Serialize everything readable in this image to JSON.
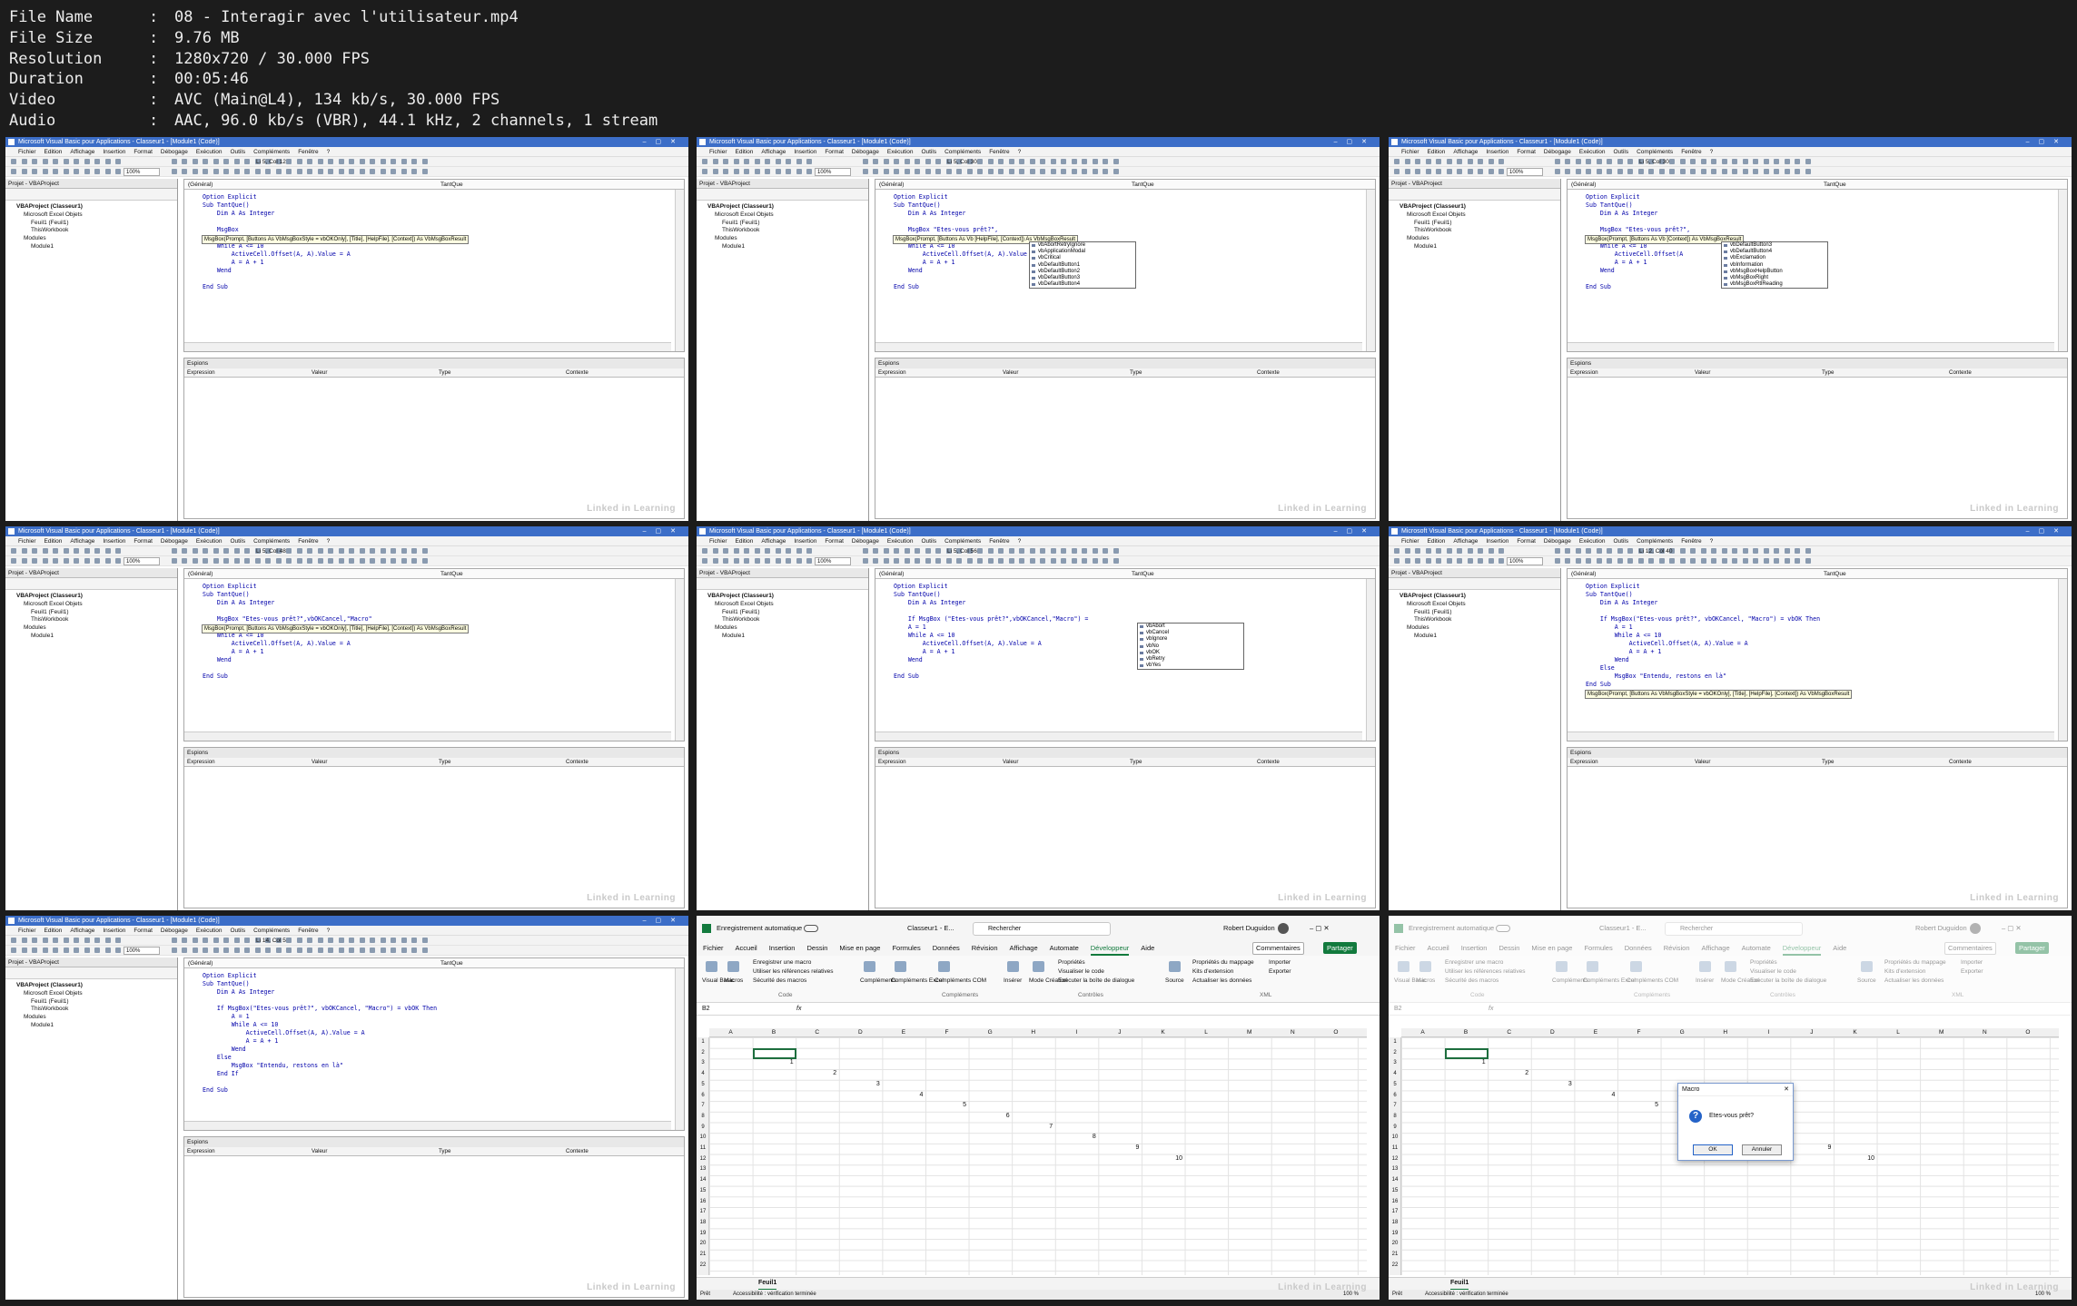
{
  "meta": [
    {
      "key": "File Name",
      "value": "08 - Interagir avec l'utilisateur.mp4"
    },
    {
      "key": "File Size",
      "value": "9.76 MB"
    },
    {
      "key": "Resolution",
      "value": "1280x720 / 30.000 FPS"
    },
    {
      "key": "Duration",
      "value": "00:05:46"
    },
    {
      "key": "Video",
      "value": "AVC (Main@L4), 134 kb/s, 30.000 FPS"
    },
    {
      "key": "Audio",
      "value": "AAC, 96.0 kb/s (VBR), 44.1 kHz, 2 channels, 1 stream"
    }
  ],
  "vba": {
    "title": "Microsoft Visual Basic pour Applications - Classeur1 - [Module1 (Code)]",
    "menu": [
      "Fichier",
      "Edition",
      "Affichage",
      "Insertion",
      "Format",
      "Débogage",
      "Exécution",
      "Outils",
      "Compléments",
      "Fenêtre",
      "?"
    ],
    "zoom": "100%",
    "project_header": "Projet - VBAProject",
    "tree": [
      "VBAProject (Classeur1)",
      "Microsoft Excel Objets",
      "Feuil1 (Feuil1)",
      "ThisWorkbook",
      "Modules",
      "Module1"
    ],
    "dropdown_left": "(Général)",
    "dropdown_right": "TantQue",
    "espions_title": "Espions",
    "espions_cols": [
      "Expression",
      "Valeur",
      "Type",
      "Contexte"
    ],
    "watermark": "Linked in Learning"
  },
  "vba_frames": [
    {
      "pos": "Li 5, Col 12",
      "code": [
        "Option Explicit",
        "Sub TantQue()",
        "    Dim A As Integer",
        "",
        "    MsgBox",
        "",
        "    While A <= 10",
        "        ActiveCell.Offset(A, A).Value = A",
        "        A = A + 1",
        "    Wend",
        "",
        "End Sub"
      ],
      "tip": "MsgBox(Prompt, [Buttons As VbMsgBoxStyle = vbOKOnly], [Title], [HelpFile], [Context]) As VbMsgBoxResult",
      "tip_line": 5,
      "list": []
    },
    {
      "pos": "Li 5, Col 30",
      "code": [
        "Option Explicit",
        "Sub TantQue()",
        "    Dim A As Integer",
        "",
        "    MsgBox \"Etes-vous prêt?\",",
        "",
        "    While A <= 10",
        "        ActiveCell.Offset(A, A).Value = A",
        "        A = A + 1",
        "    Wend",
        "",
        "End Sub"
      ],
      "tip": "MsgBox(Prompt, [Buttons As Vb                    [HelpFile], [Context]) As VbMsgBoxResult",
      "tip_line": 5,
      "list": [
        "vbAbortRetryIgnore",
        "vbApplicationModal",
        "vbCritical",
        "vbDefaultButton1",
        "vbDefaultButton2",
        "vbDefaultButton3",
        "vbDefaultButton4"
      ]
    },
    {
      "pos": "Li 5, Col 30",
      "code": [
        "Option Explicit",
        "Sub TantQue()",
        "    Dim A As Integer",
        "",
        "    MsgBox \"Etes-vous prêt?\",",
        "",
        "    While A <= 10",
        "        ActiveCell.Offset(A",
        "        A = A + 1",
        "    Wend",
        "",
        "End Sub"
      ],
      "tip": "MsgBox(Prompt, [Buttons As Vb                 [Context]) As VbMsgBoxResult",
      "tip_line": 5,
      "list": [
        "vbDefaultButton3",
        "vbDefaultButton4",
        "vbExclamation",
        "vbInformation",
        "vbMsgBoxHelpButton",
        "vbMsgBoxRight",
        "vbMsgBoxRtlReading"
      ]
    },
    {
      "pos": "Li 5, Col 48",
      "code": [
        "Option Explicit",
        "Sub TantQue()",
        "    Dim A As Integer",
        "",
        "    MsgBox \"Etes-vous prêt?\",vbOKCancel,\"Macro\"",
        "",
        "    While A <= 10",
        "        ActiveCell.Offset(A, A).Value = A",
        "        A = A + 1",
        "    Wend",
        "",
        "End Sub"
      ],
      "tip": "MsgBox(Prompt, [Buttons As VbMsgBoxStyle = vbOKOnly], [Title], [HelpFile], [Context]) As VbMsgBoxResult",
      "tip_line": 5,
      "list": []
    },
    {
      "pos": "Li 5, Col 56",
      "code": [
        "Option Explicit",
        "Sub TantQue()",
        "    Dim A As Integer",
        "",
        "    If MsgBox (\"Etes-vous prêt?\",vbOKCancel,\"Macro\") =",
        "    A = 1",
        "    While A <= 10",
        "        ActiveCell.Offset(A, A).Value = A",
        "        A = A + 1",
        "    Wend",
        "",
        "End Sub"
      ],
      "tip": "",
      "tip_line": 0,
      "list": [
        "vbAbort",
        "vbCancel",
        "vbIgnore",
        "vbNo",
        "vbOK",
        "vbRetry",
        "vbYes"
      ]
    },
    {
      "pos": "Li 12, Col 40",
      "code": [
        "Option Explicit",
        "Sub TantQue()",
        "    Dim A As Integer",
        "",
        "    If MsgBox(\"Etes-vous prêt?\", vbOKCancel, \"Macro\") = vbOK Then",
        "        A = 1",
        "        While A <= 10",
        "            ActiveCell.Offset(A, A).Value = A",
        "            A = A + 1",
        "        Wend",
        "    Else",
        "        MsgBox \"Entendu, restons en là\"",
        "End Sub"
      ],
      "tip": "MsgBox(Prompt, [Buttons As VbMsgBoxStyle = vbOKOnly], [Title], [HelpFile], [Context]) As VbMsgBoxResult",
      "tip_line": 13,
      "list": []
    },
    {
      "pos": "Li 14, Col 5",
      "code": [
        "Option Explicit",
        "Sub TantQue()",
        "    Dim A As Integer",
        "",
        "    If MsgBox(\"Etes-vous prêt?\", vbOKCancel, \"Macro\") = vbOK Then",
        "        A = 1",
        "        While A <= 10",
        "            ActiveCell.Offset(A, A).Value = A",
        "            A = A + 1",
        "        Wend",
        "    Else",
        "        MsgBox \"Entendu, restons en là\"",
        "    End If",
        "",
        "End Sub"
      ],
      "tip": "",
      "tip_line": 0,
      "list": []
    }
  ],
  "excel": {
    "autosave": "Enregistrement automatique",
    "filename": "Classeur1 - E...",
    "search": "Rechercher",
    "user": "Robert Duguidon",
    "tabs": [
      "Fichier",
      "Accueil",
      "Insertion",
      "Dessin",
      "Mise en page",
      "Formules",
      "Données",
      "Révision",
      "Affichage",
      "Automate",
      "Développeur",
      "Aide"
    ],
    "comments": "Commentaires",
    "share": "Partager",
    "ribbon_items": [
      "Visual Basic",
      "Macros",
      "Enregistrer une macro",
      "Utiliser les références relatives",
      "Sécurité des macros",
      "Compléments",
      "Compléments Excel",
      "Compléments COM",
      "Insérer",
      "Mode Création",
      "Propriétés",
      "Visualiser le code",
      "Exécuter la boîte de dialogue",
      "Source",
      "Propriétés du mappage",
      "Kits d'extension",
      "Actualiser les données",
      "Importer",
      "Exporter"
    ],
    "groups": [
      "Code",
      "Compléments",
      "Contrôles",
      "XML"
    ],
    "namebox": "B2",
    "cols": [
      "A",
      "B",
      "C",
      "D",
      "E",
      "F",
      "G",
      "H",
      "I",
      "J",
      "K",
      "L",
      "M",
      "N",
      "O"
    ],
    "rows": [
      "1",
      "2",
      "3",
      "4",
      "5",
      "6",
      "7",
      "8",
      "9",
      "10",
      "11",
      "12",
      "13",
      "14",
      "15",
      "16",
      "17",
      "18",
      "19",
      "20",
      "21",
      "22"
    ],
    "values": [
      "1",
      "2",
      "3",
      "4",
      "5",
      "6",
      "7",
      "8",
      "9",
      "10"
    ],
    "sheet": "Feuil1",
    "status_ready": "Prêt",
    "status_access": "Accessibilité : vérification terminée",
    "zoom": "100 %"
  },
  "dialog": {
    "title": "Macro",
    "message": "Etes-vous prêt?",
    "ok": "OK",
    "cancel": "Annuler"
  },
  "colors": {
    "vba_title": "#3c6ec8",
    "excel_green": "#127a3d",
    "tooltip": "#ffffe1",
    "dialog_icon": "#2563c8"
  }
}
